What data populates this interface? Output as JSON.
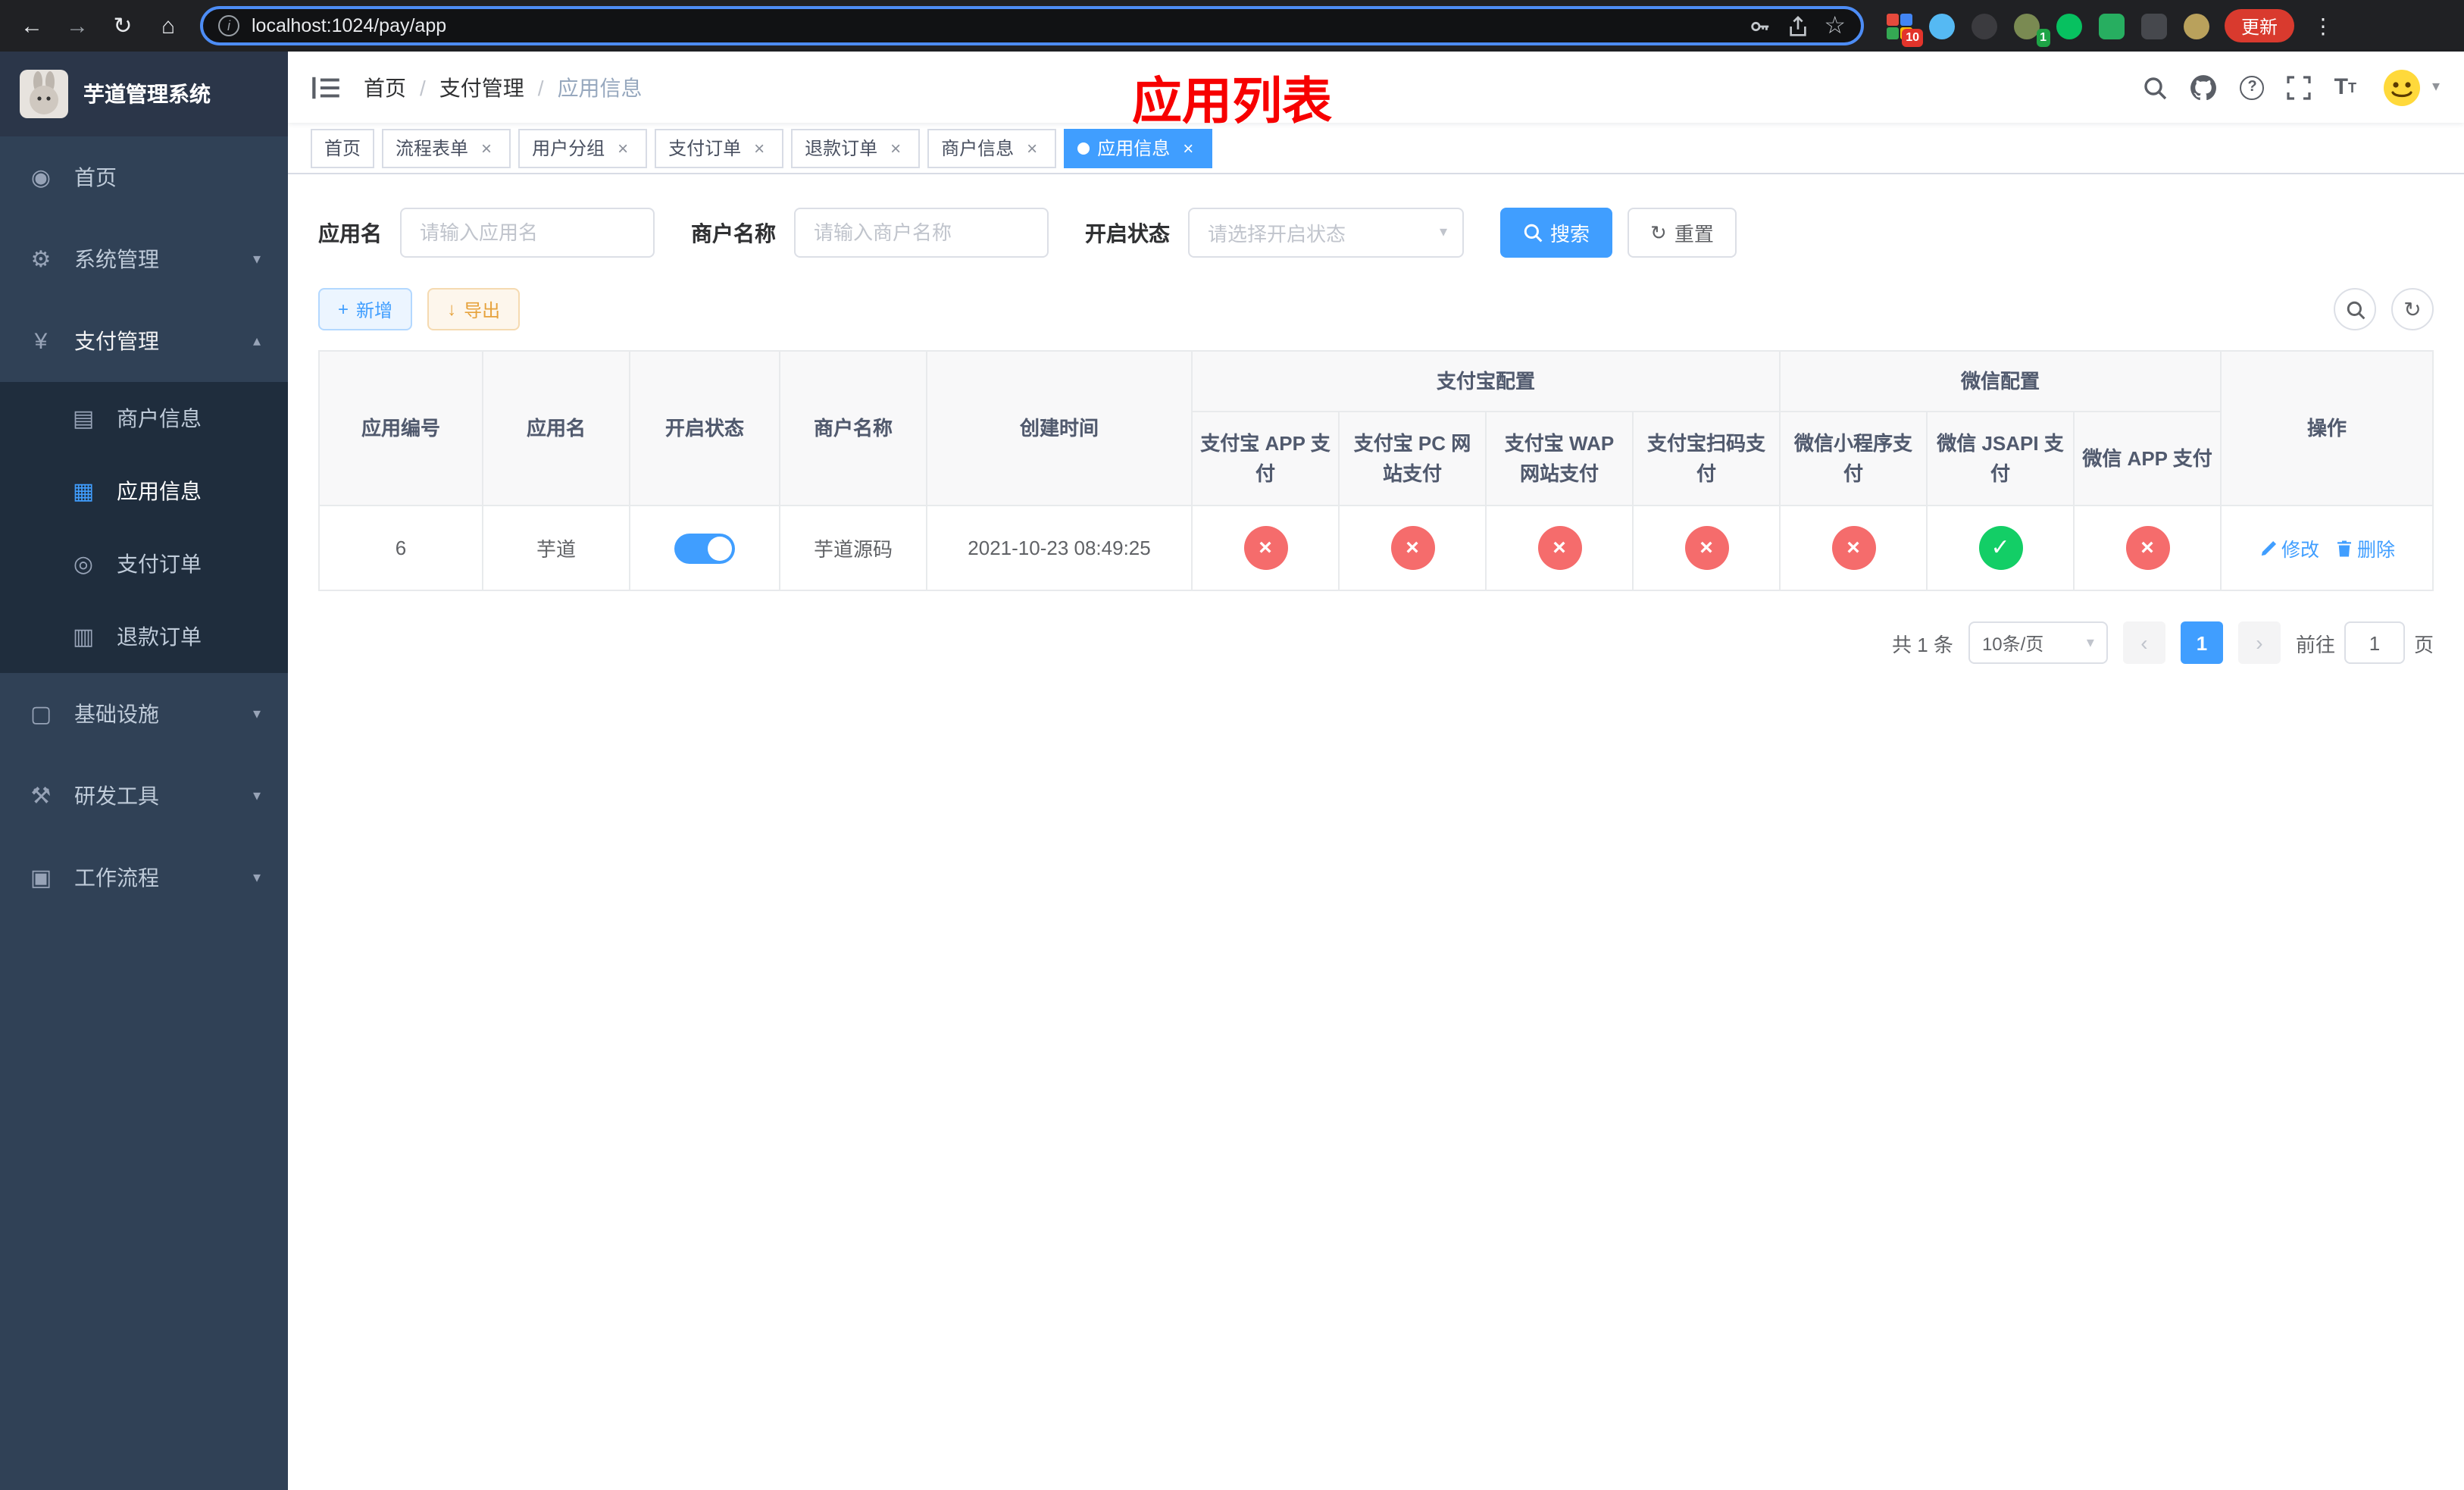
{
  "browser": {
    "url": "localhost:1024/pay/app",
    "update_label": "更新",
    "extension_badges": {
      "devtools": "10",
      "profile": "1"
    }
  },
  "app": {
    "title": "芋道管理系统"
  },
  "sidebar": {
    "items": [
      {
        "label": "首页"
      },
      {
        "label": "系统管理"
      },
      {
        "label": "支付管理"
      },
      {
        "label": "商户信息"
      },
      {
        "label": "应用信息"
      },
      {
        "label": "支付订单"
      },
      {
        "label": "退款订单"
      },
      {
        "label": "基础设施"
      },
      {
        "label": "研发工具"
      },
      {
        "label": "工作流程"
      }
    ]
  },
  "header": {
    "breadcrumb": {
      "home": "首页",
      "section": "支付管理",
      "current": "应用信息"
    },
    "overlay_title": "应用列表"
  },
  "tabs": [
    {
      "label": "首页",
      "closable": false,
      "active": false
    },
    {
      "label": "流程表单",
      "closable": true,
      "active": false
    },
    {
      "label": "用户分组",
      "closable": true,
      "active": false
    },
    {
      "label": "支付订单",
      "closable": true,
      "active": false
    },
    {
      "label": "退款订单",
      "closable": true,
      "active": false
    },
    {
      "label": "商户信息",
      "closable": true,
      "active": false
    },
    {
      "label": "应用信息",
      "closable": true,
      "active": true
    }
  ],
  "filters": {
    "app_name": {
      "label": "应用名",
      "placeholder": "请输入应用名",
      "value": ""
    },
    "merchant_name": {
      "label": "商户名称",
      "placeholder": "请输入商户名称",
      "value": ""
    },
    "status": {
      "label": "开启状态",
      "placeholder": "请选择开启状态",
      "value": ""
    },
    "search_label": "搜索",
    "reset_label": "重置"
  },
  "toolbar": {
    "add_label": "新增",
    "export_label": "导出"
  },
  "table": {
    "columns": {
      "app_id": "应用编号",
      "app_name": "应用名",
      "open_status": "开启状态",
      "merchant_name": "商户名称",
      "create_time": "创建时间",
      "alipay_group": "支付宝配置",
      "wechat_group": "微信配置",
      "actions": "操作",
      "alipay_app": "支付宝 APP 支付",
      "alipay_pc": "支付宝 PC 网站支付",
      "alipay_wap": "支付宝 WAP 网站支付",
      "alipay_qr": "支付宝扫码支付",
      "wx_mini": "微信小程序支付",
      "wx_jsapi": "微信 JSAPI 支付",
      "wx_app": "微信 APP 支付"
    },
    "row": {
      "app_id": "6",
      "app_name": "芋道",
      "enabled": true,
      "merchant_name": "芋道源码",
      "create_time": "2021-10-23 08:49:25",
      "statuses": [
        "fail",
        "fail",
        "fail",
        "fail",
        "fail",
        "success",
        "fail"
      ],
      "edit_label": "修改",
      "delete_label": "删除"
    }
  },
  "pagination": {
    "total_text": "共 1 条",
    "page_size": "10条/页",
    "current_page": "1",
    "goto_prefix": "前往",
    "goto_value": "1",
    "goto_suffix": "页"
  },
  "colors": {
    "accent": "#409eff",
    "danger": "#f56c6c",
    "success": "#13ce66",
    "warning": "#e6a23c",
    "sidebar_bg": "#304156",
    "overlay_red": "#f70000"
  }
}
